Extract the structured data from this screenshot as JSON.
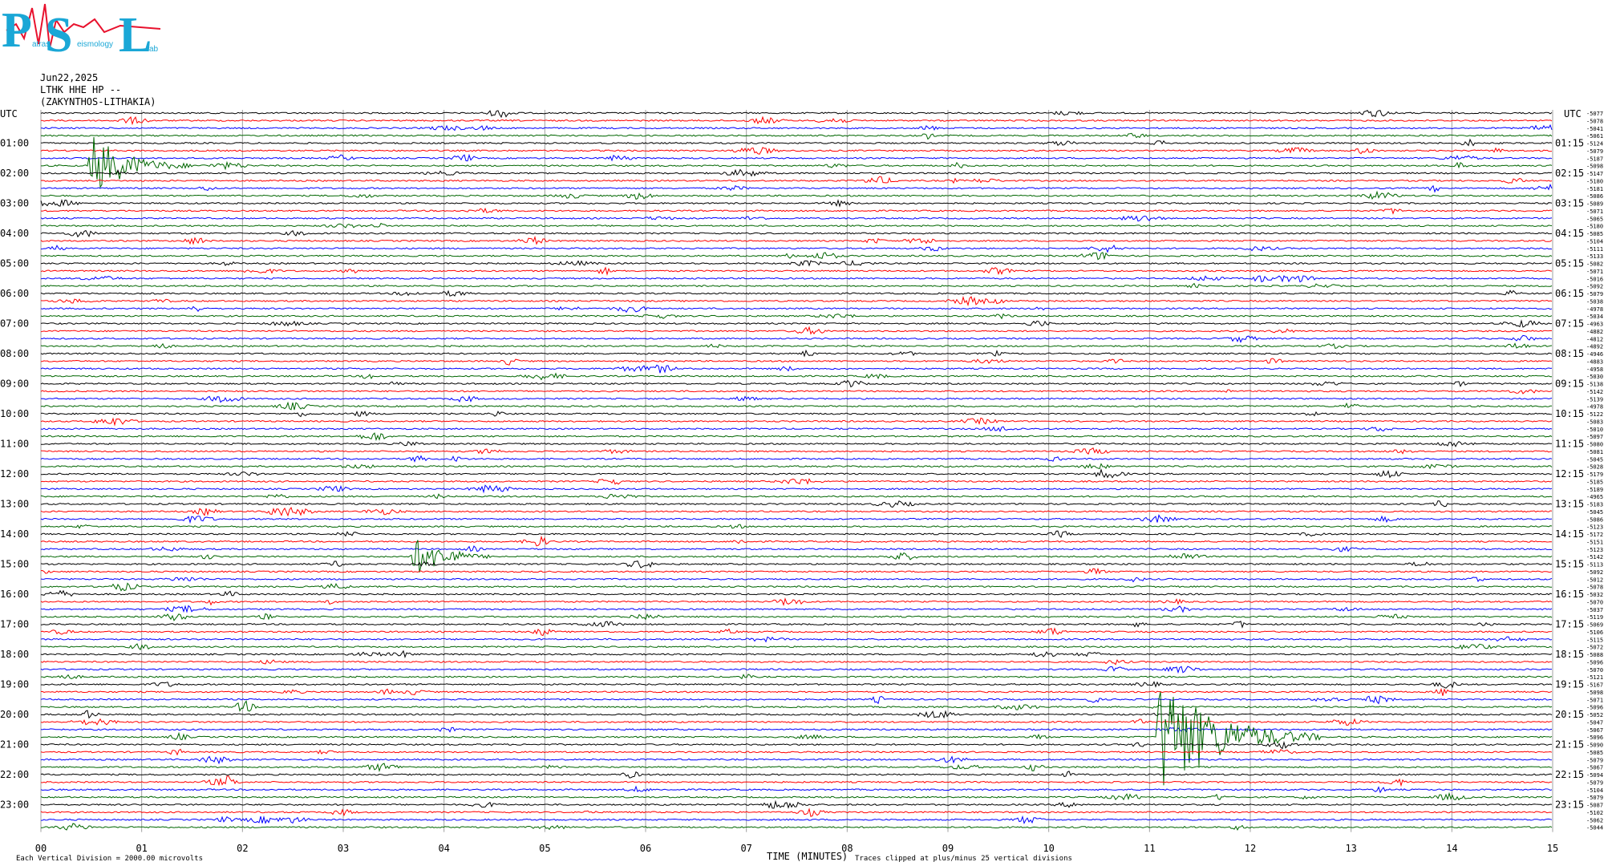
{
  "logo": {
    "letters": [
      "P",
      "S",
      "L"
    ],
    "words": [
      "atras",
      "eismology",
      "ab"
    ],
    "primary_color": "#1aa7d6",
    "accent_color": "#e8112d"
  },
  "header": {
    "date": "Jun22,2025",
    "station_line": "LTHK HHE HP --",
    "location": "(ZAKYNTHOS-LITHAKIA)"
  },
  "chart_data": {
    "type": "line",
    "title": "",
    "xlabel": "TIME (MINUTES)",
    "x_ticks": [
      "00",
      "01",
      "02",
      "03",
      "04",
      "05",
      "06",
      "07",
      "08",
      "09",
      "10",
      "11",
      "12",
      "13",
      "14",
      "15"
    ],
    "xlim": [
      0,
      15
    ],
    "left_axis_title": "UTC",
    "right_axis_title": "UTC",
    "left_labels": [
      "01:00",
      "02:00",
      "03:00",
      "04:00",
      "05:00",
      "06:00",
      "07:00",
      "08:00",
      "09:00",
      "10:00",
      "11:00",
      "12:00",
      "13:00",
      "14:00",
      "15:00",
      "16:00",
      "17:00",
      "18:00",
      "19:00",
      "20:00",
      "21:00",
      "22:00",
      "23:00"
    ],
    "right_labels": [
      "01:15",
      "02:15",
      "03:15",
      "04:15",
      "05:15",
      "06:15",
      "07:15",
      "08:15",
      "09:15",
      "10:15",
      "11:15",
      "12:15",
      "13:15",
      "14:15",
      "15:15",
      "16:15",
      "17:15",
      "18:15",
      "19:15",
      "20:15",
      "21:15",
      "22:15",
      "23:15"
    ],
    "trace_count": 96,
    "trace_minutes": 15,
    "trace_colors": [
      "#000000",
      "#ff0000",
      "#0000ff",
      "#006600"
    ],
    "grid_color": "#a0a0a0",
    "grid": true,
    "offsets": [
      "-5077",
      "-5078",
      "-5041",
      "-5061",
      "-5124",
      "-5079",
      "-5187",
      "-5098",
      "-5147",
      "-5180",
      "-5181",
      "-5086",
      "-5089",
      "-5071",
      "-5065",
      "-5180",
      "-5085",
      "-5104",
      "-5111",
      "-5133",
      "-5082",
      "-5071",
      "-5016",
      "-5092",
      "-5079",
      "-5038",
      "-4978",
      "-5034",
      "-4963",
      "-4882",
      "-4812",
      "-4892",
      "-4946",
      "-4883",
      "-4958",
      "-5030",
      "-5138",
      "-5142",
      "-5139",
      "-4978",
      "-5122",
      "-5083",
      "-5010",
      "-5097",
      "-5080",
      "-5081",
      "-5045",
      "-5028",
      "-5179",
      "-5185",
      "-5189",
      "-4965",
      "-5183",
      "-5045",
      "-5086",
      "-5123",
      "-5172",
      "-5151",
      "-5123",
      "-5142",
      "-5113",
      "-5092",
      "-5012",
      "-5078",
      "-5032",
      "-5070",
      "-5037",
      "-5119",
      "-5069",
      "-5106",
      "-5115",
      "-5072",
      "-5088",
      "-5096",
      "-5070",
      "-5121",
      "-5167",
      "-5098",
      "-5071",
      "-5096",
      "-5052",
      "-5047",
      "-5067",
      "-5096",
      "-5090",
      "-5085",
      "-5079",
      "-5067",
      "-5094",
      "-5079",
      "-5104",
      "-5079",
      "-5087",
      "-5102",
      "-5062",
      "-5044"
    ],
    "events": [
      {
        "trace": 7,
        "minute": 0.5,
        "amplitude": 40,
        "duration": 1.0,
        "label": ""
      },
      {
        "trace": 59,
        "minute": 3.7,
        "amplitude": 24,
        "duration": 0.8,
        "label": ""
      },
      {
        "trace": 83,
        "minute": 11.1,
        "amplitude": 80,
        "duration": 1.6,
        "label": ""
      }
    ],
    "footer_left": "Each Vertical Division = 2000.00 microvolts",
    "footer_right": "Traces clipped at plus/minus 25 vertical divisions"
  }
}
